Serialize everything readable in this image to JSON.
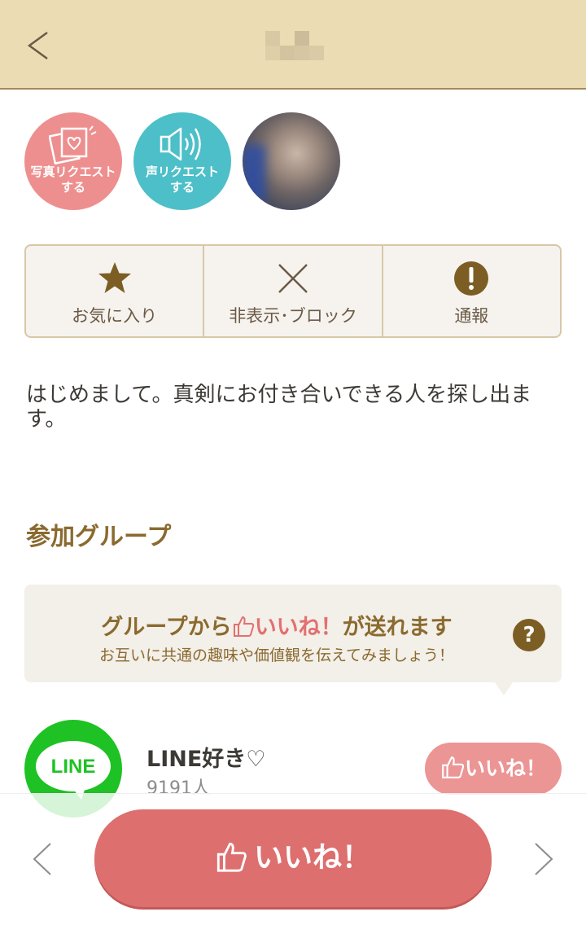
{
  "header": {
    "title": ""
  },
  "circles": {
    "photo_request_label": "写真リクエスト\nする",
    "voice_request_label": "声リクエスト\nする"
  },
  "actions": {
    "favorite_label": "お気に入り",
    "hide_block_label": "非表示･ブロック",
    "report_label": "通報"
  },
  "profile": {
    "intro": "はじめまして。真剣にお付き合いできる人を探し出ます。"
  },
  "groups_section": {
    "title": "参加グループ",
    "info_line1_prefix": "グループから",
    "info_line1_like": "いいね！",
    "info_line1_suffix": "が送れます",
    "info_line2": "お互いに共通の趣味や価値観を伝えてみましょう！",
    "help_symbol": "?",
    "groups": [
      {
        "logo_text": "LINE",
        "name": "LINE好き♡",
        "members": "9191人",
        "like_label": "いいね！"
      }
    ]
  },
  "footer": {
    "like_label": "いいね！"
  },
  "colors": {
    "header_bg": "#ecdcb4",
    "accent_brown": "#8a6a2e",
    "like_pink": "#de6f6f",
    "voice_teal": "#4dbfc8",
    "photo_pink": "#ee8f8f",
    "line_green": "#1ec224"
  }
}
